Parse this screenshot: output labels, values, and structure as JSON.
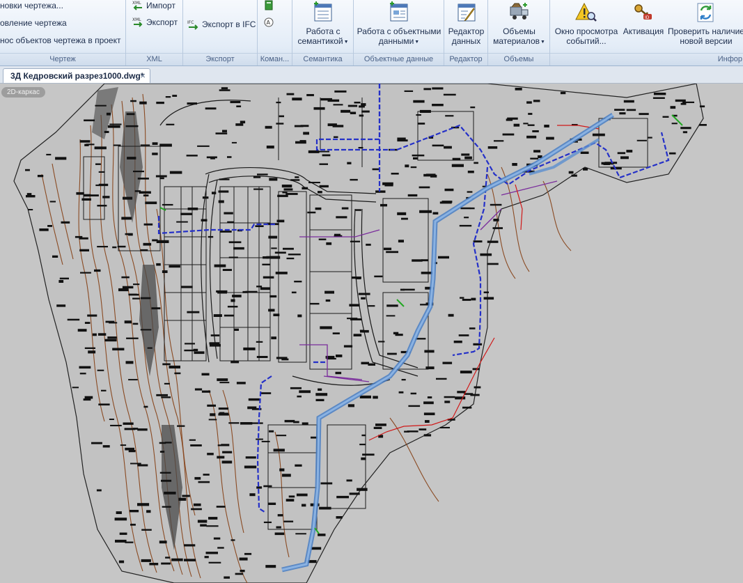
{
  "ribbon": {
    "drawing_group": {
      "label": "Чертеж",
      "items": [
        "новки чертежа...",
        "овление чертежа",
        "нос объектов чертежа в проект"
      ]
    },
    "xml_group": {
      "label": "XML",
      "import_label": "Импорт",
      "export_label": "Экспорт"
    },
    "export_group": {
      "label": "Экспорт",
      "ifc_label": "Экспорт в IFC"
    },
    "commands_group": {
      "label": "Коман..."
    },
    "semantics_group": {
      "label": "Семантика",
      "button_line1": "Работа с",
      "button_line2": "семантикой"
    },
    "objdata_group": {
      "label": "Объектные данные",
      "button_line1": "Работа с объектными",
      "button_line2": "данными"
    },
    "editor_group": {
      "label": "Редактор",
      "button_line1": "Редактор",
      "button_line2": "данных"
    },
    "volumes_group": {
      "label": "Объемы",
      "button_line1": "Объемы",
      "button_line2": "материалов"
    },
    "info_group": {
      "label": "Инфор",
      "events_line1": "Окно просмотра",
      "events_line2": "событий...",
      "activation_label": "Активация",
      "update_line1": "Проверить наличие",
      "update_line2": "новой версии"
    }
  },
  "document_tab": {
    "title": "3Д Кедровский разрез1000.dwg*",
    "close_glyph": "×"
  },
  "viewport": {
    "view_mode": "2D-каркас"
  },
  "icons": [
    "xml-import-icon",
    "xml-export-icon",
    "ifc-export-icon",
    "semantics-table-icon",
    "object-data-icon",
    "data-editor-icon",
    "materials-truck-icon",
    "warning-search-icon",
    "activation-key-icon",
    "update-arrows-icon"
  ],
  "colors": {
    "canvas_bg": "#c6c6c6",
    "linework": "#111111",
    "contours": "#8a4a22",
    "route_main": "#5b8fd0",
    "route_secondary": "#2430c8",
    "purple_lines": "#7a2c9c",
    "red_lines": "#d01818"
  }
}
